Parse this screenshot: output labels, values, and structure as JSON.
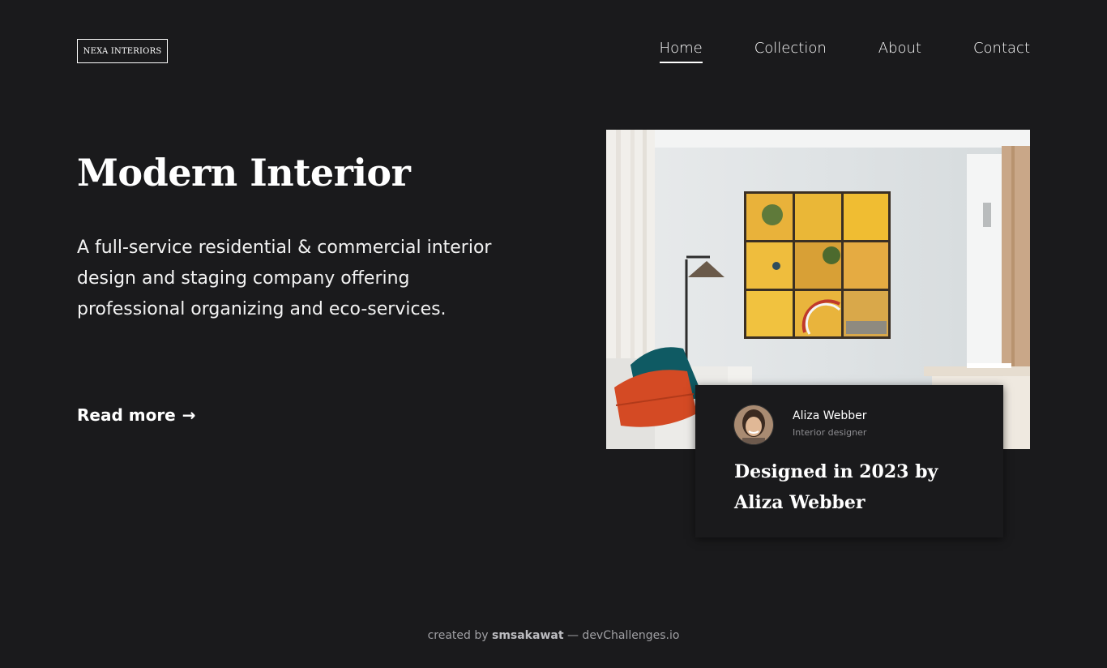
{
  "brand": {
    "logo": "NEXA INTERIORS"
  },
  "nav": {
    "items": [
      {
        "label": "Home",
        "active": true
      },
      {
        "label": "Collection",
        "active": false
      },
      {
        "label": "About",
        "active": false
      },
      {
        "label": "Contact",
        "active": false
      }
    ]
  },
  "hero": {
    "title": "Modern Interior",
    "description": "A full-service residential & commercial interior design and staging company offering professional organizing and eco-services.",
    "cta_label": "Read more",
    "cta_icon": "arrow-right-icon",
    "cta_arrow": "→"
  },
  "feature": {
    "image_name": "living-room-photo",
    "author_name": "Aliza Webber",
    "author_role": "Interior designer",
    "title": "Designed in 2023 by Aliza Webber"
  },
  "footer": {
    "prefix": "created by",
    "author": "smsakawat",
    "suffix": "— devChallenges.io"
  },
  "colors": {
    "background": "#1a1a1c",
    "text": "#ffffff",
    "muted": "#8d8d91"
  }
}
